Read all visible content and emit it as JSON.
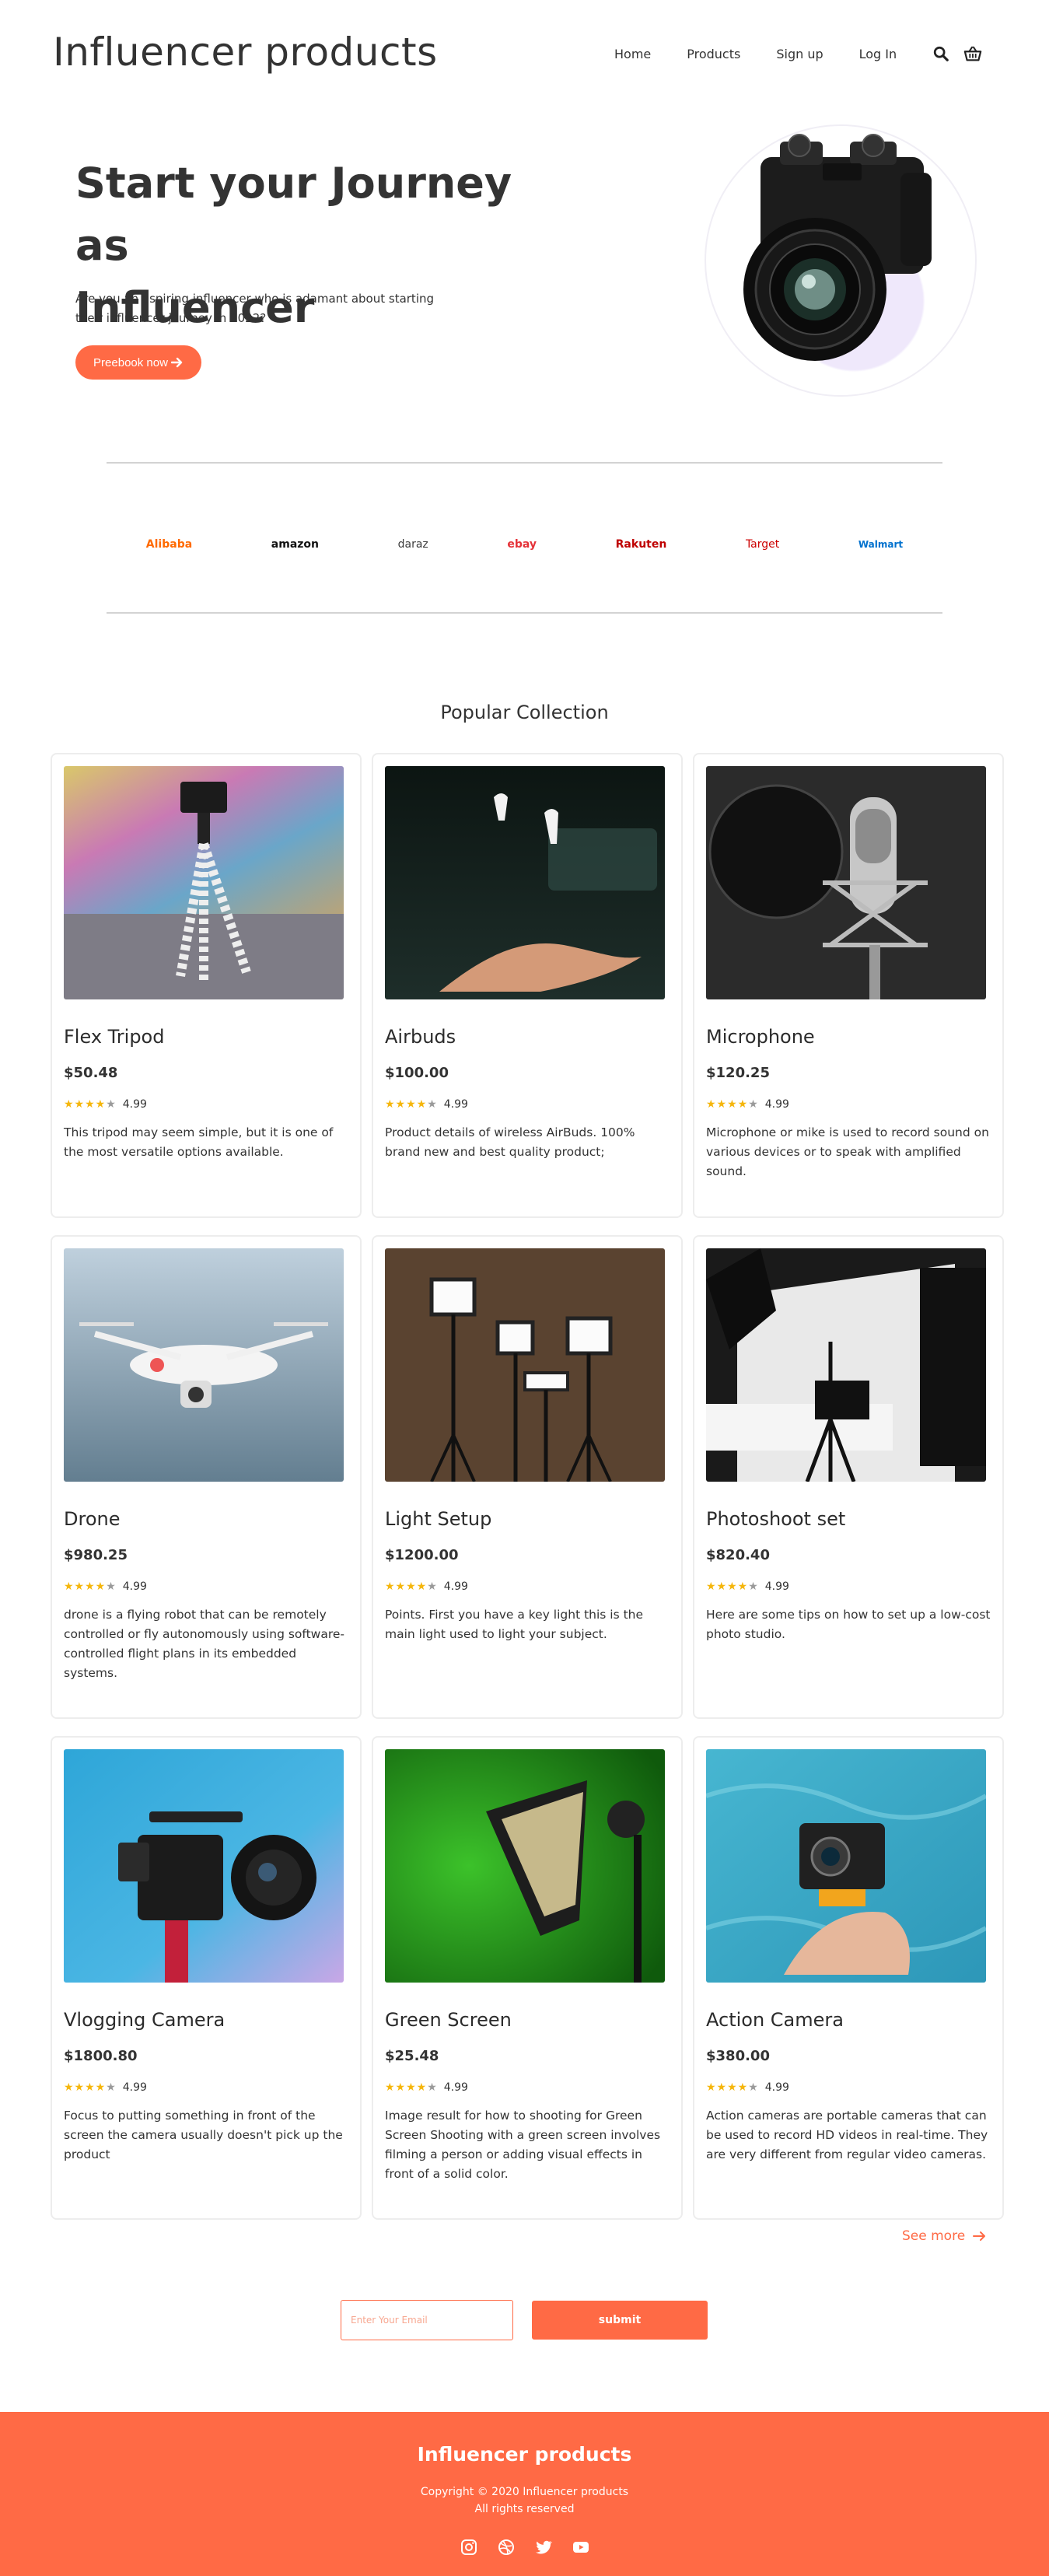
{
  "header": {
    "brand": "Influencer products",
    "nav": [
      "Home",
      "Products",
      "Sign up",
      "Log In"
    ]
  },
  "hero": {
    "title_line1": "Start your Journey as",
    "title_line2": "Influencer",
    "subtitle": "Are you an aspiring influencer who is adamant about starting their influencer journey in 2022?",
    "button": "Preebook now"
  },
  "logos": [
    "Alibaba",
    "amazon",
    "daraz",
    "ebay",
    "Rakuten",
    "Target",
    "Walmart"
  ],
  "logo_colors": [
    "#ff6a00",
    "#111111",
    "#3a3a3a",
    "#e53238",
    "#bf0000",
    "#cc0000",
    "#0071ce"
  ],
  "collection": {
    "title": "Popular Collection",
    "see_more": "See more",
    "products": [
      {
        "title": "Flex Tripod",
        "price": "$50.48",
        "rating": "4.99",
        "desc": "This tripod may seem simple, but it is one of the most versatile options available."
      },
      {
        "title": "Airbuds",
        "price": "$100.00",
        "rating": "4.99",
        "desc": "Product details of wireless AirBuds. 100% brand new and best quality product;"
      },
      {
        "title": "Microphone",
        "price": "$120.25",
        "rating": "4.99",
        "desc": "Microphone or mike is used to record sound on various devices or to speak with amplified sound."
      },
      {
        "title": "Drone",
        "price": "$980.25",
        "rating": "4.99",
        "desc": "drone is a flying robot that can be remotely controlled or fly autonomously using software-controlled flight plans in its embedded systems."
      },
      {
        "title": "Light Setup",
        "price": "$1200.00",
        "rating": "4.99",
        "desc": "Points. First you have a key light this is the main light used to light your subject."
      },
      {
        "title": "Photoshoot set",
        "price": "$820.40",
        "rating": "4.99",
        "desc": "Here are some tips on how to set up a low-cost photo studio."
      },
      {
        "title": "Vlogging Camera",
        "price": "$1800.80",
        "rating": "4.99",
        "desc": "Focus to putting something in front of the screen the camera usually doesn't pick up the product"
      },
      {
        "title": "Green Screen",
        "price": "$25.48",
        "rating": "4.99",
        "desc": "Image result for how to shooting for Green Screen Shooting with a green screen involves filming a person or adding visual effects in front of a solid color."
      },
      {
        "title": "Action Camera",
        "price": "$380.00",
        "rating": "4.99",
        "desc": "Action cameras are portable cameras that can be used to record HD videos in real-time. They are very different from regular video cameras."
      }
    ]
  },
  "subscribe": {
    "placeholder": "Enter Your Email",
    "button": "submit"
  },
  "footer": {
    "brand": "Influencer products",
    "copyright": "Copyright © 2020 Influencer products",
    "rights": "All rights reserved"
  },
  "colors": {
    "accent": "#ff6a45",
    "star": "#f5b60c"
  }
}
